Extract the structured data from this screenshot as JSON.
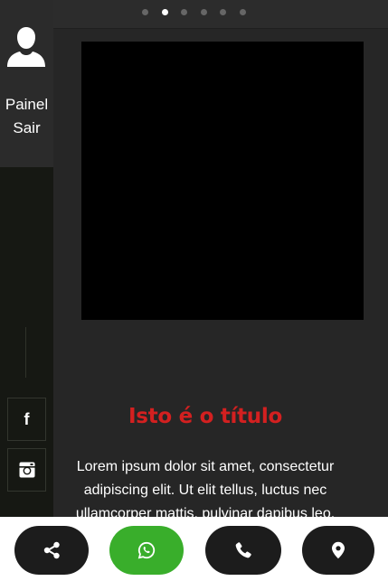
{
  "sidebar": {
    "avatar_icon": "user-icon",
    "links": {
      "painel": "Painel",
      "sair": "Sair"
    },
    "social": {
      "facebook_icon": "facebook-icon",
      "instagram_icon": "instagram-icon"
    }
  },
  "carousel": {
    "slide_count": 6,
    "active_index": 1
  },
  "content": {
    "title": "Isto é o título",
    "body": "Lorem ipsum dolor sit amet, consectetur adipiscing elit. Ut elit tellus, luctus nec ullamcorper mattis, pulvinar dapibus leo."
  },
  "actions": {
    "share_icon": "share-icon",
    "whatsapp_icon": "whatsapp-icon",
    "phone_icon": "phone-icon",
    "location_icon": "location-icon"
  },
  "colors": {
    "title": "#d32020",
    "whatsapp": "#39ae2b",
    "action_dark": "#1c1c1c",
    "sidebar": "#161813"
  }
}
